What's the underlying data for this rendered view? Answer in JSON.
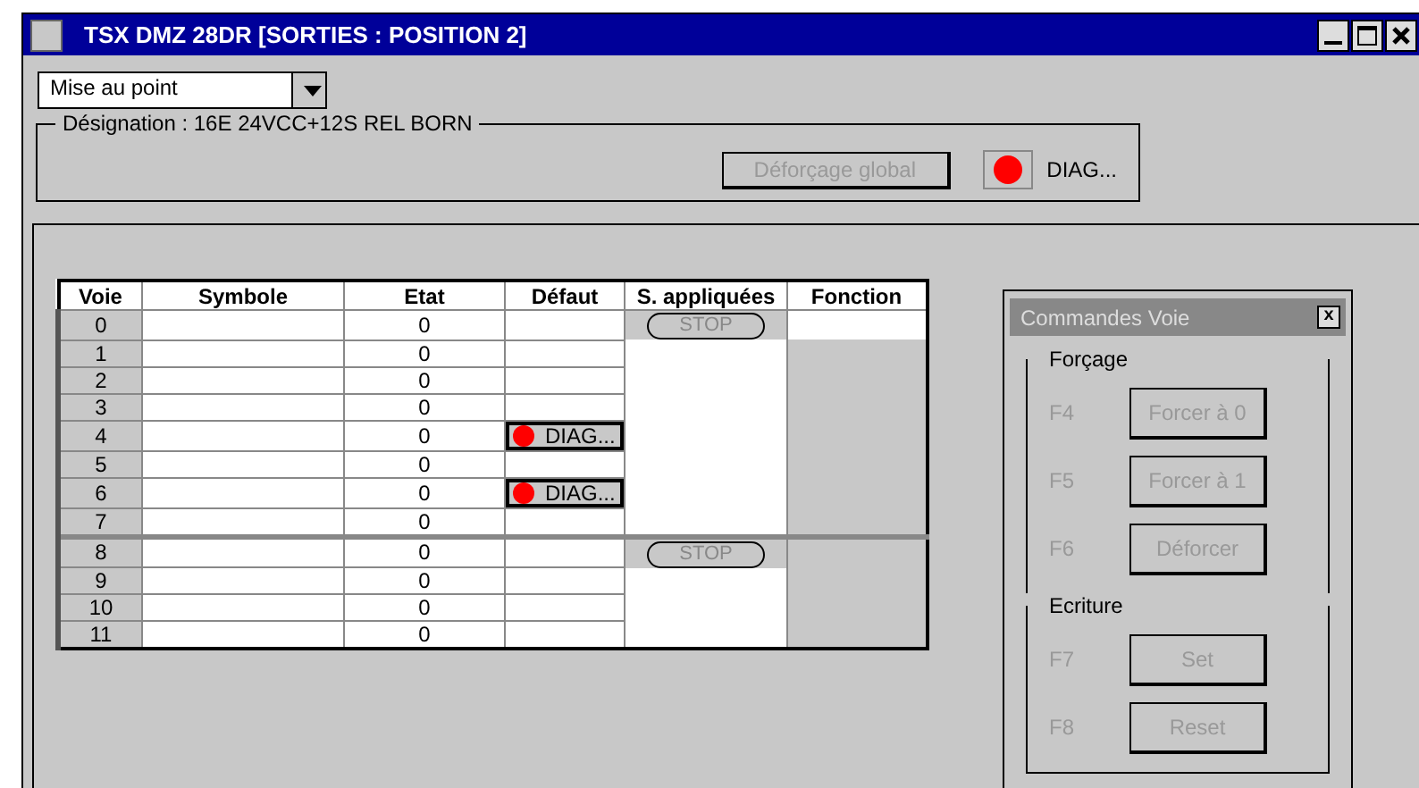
{
  "window": {
    "title": "TSX DMZ 28DR  [SORTIES : POSITION 2]"
  },
  "mode_dropdown": {
    "value": "Mise au point"
  },
  "designation": {
    "label": "Désignation : 16E 24VCC+12S REL BORN",
    "unforce_button": {
      "label": "Déforçage global",
      "disabled": true
    },
    "diag_button": {
      "label": "DIAG...",
      "fault": true
    }
  },
  "table": {
    "columns": [
      "Voie",
      "Symbole",
      "Etat",
      "Défaut",
      "S. appliquées",
      "Fonction"
    ],
    "rows": [
      {
        "voie": "0",
        "etat": "0",
        "fault": false,
        "applied": "STOP",
        "selected": true
      },
      {
        "voie": "1",
        "etat": "0",
        "fault": false,
        "selected": false
      },
      {
        "voie": "2",
        "etat": "0",
        "fault": false,
        "selected": false
      },
      {
        "voie": "3",
        "etat": "0",
        "fault": false,
        "selected": false
      },
      {
        "voie": "4",
        "etat": "0",
        "fault": true,
        "diag": "DIAG...",
        "selected": false
      },
      {
        "voie": "5",
        "etat": "0",
        "fault": false,
        "selected": false
      },
      {
        "voie": "6",
        "etat": "0",
        "fault": true,
        "diag": "DIAG...",
        "selected": false
      },
      {
        "voie": "7",
        "etat": "0",
        "fault": false,
        "selected": false
      },
      {
        "voie": "8",
        "etat": "0",
        "fault": false,
        "applied": "STOP",
        "selected": false
      },
      {
        "voie": "9",
        "etat": "0",
        "fault": false,
        "selected": false
      },
      {
        "voie": "10",
        "etat": "0",
        "fault": false,
        "selected": false
      },
      {
        "voie": "11",
        "etat": "0",
        "fault": false,
        "selected": false
      }
    ]
  },
  "command_panel": {
    "title": "Commandes Voie",
    "close": "x",
    "groups": [
      {
        "label": "Forçage",
        "commands": [
          {
            "key": "F4",
            "label": "Forcer à 0",
            "disabled": true
          },
          {
            "key": "F5",
            "label": "Forcer à 1",
            "disabled": true
          },
          {
            "key": "F6",
            "label": "Déforcer",
            "disabled": true
          }
        ]
      },
      {
        "label": "Ecriture",
        "commands": [
          {
            "key": "F7",
            "label": "Set",
            "disabled": true
          },
          {
            "key": "F8",
            "label": "Reset",
            "disabled": true
          }
        ]
      }
    ]
  }
}
